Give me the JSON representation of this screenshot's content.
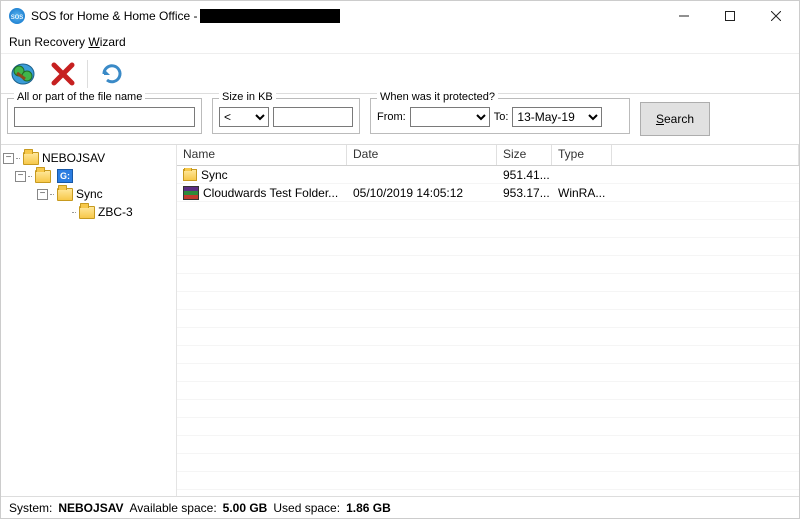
{
  "titlebar": {
    "app_icon_text": "sos",
    "title": "SOS for Home & Home Office - "
  },
  "menubar": {
    "run_recovery_html": "Run Recovery <u>W</u>izard"
  },
  "filters": {
    "filename_legend": "All or part of the file name",
    "filename_value": "",
    "size_legend": "Size in KB",
    "size_op": "<",
    "size_value": "",
    "date_legend": "When was it protected?",
    "from_label": "From:",
    "from_value": "",
    "to_label": "To:",
    "to_value": "13-May-19",
    "search_html": "<u>S</u>earch"
  },
  "tree": {
    "root": "NEBOJSAV",
    "drive_label": "G:",
    "sync": "Sync",
    "zbc": "ZBC-3"
  },
  "columns": {
    "name": "Name",
    "date": "Date",
    "size": "Size",
    "type": "Type"
  },
  "rows": [
    {
      "icon": "folder",
      "name": "Sync",
      "date": "",
      "size": "951.41...",
      "type": ""
    },
    {
      "icon": "rar",
      "name": "Cloudwards Test Folder...",
      "date": "05/10/2019 14:05:12",
      "size": "953.17...",
      "type": "WinRA..."
    }
  ],
  "status": {
    "system_label": "System:",
    "system_value": "NEBOJSAV",
    "avail_label": "Available space:",
    "avail_value": "5.00 GB",
    "used_label": "Used space:",
    "used_value": "1.86 GB"
  }
}
